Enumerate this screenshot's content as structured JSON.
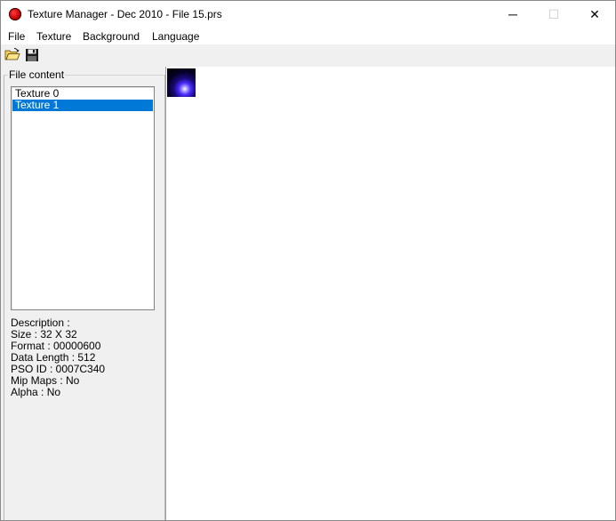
{
  "window": {
    "title": "Texture Manager - Dec 2010 - File 15.prs",
    "icon": "app-logo-icon",
    "controls": {
      "minimize": "─",
      "maximize": "☐",
      "close": "✕"
    }
  },
  "menu": {
    "items": [
      "File",
      "Texture",
      "Background",
      "Language"
    ]
  },
  "toolbar": {
    "buttons": [
      {
        "icon": "open-folder-icon"
      },
      {
        "icon": "save-disk-icon"
      }
    ]
  },
  "left_panel": {
    "group_label": "File content",
    "list": [
      {
        "label": "Texture 0",
        "selected": false
      },
      {
        "label": "Texture 1",
        "selected": true
      }
    ],
    "details": {
      "description": "Description :",
      "size": "Size : 32 X 32",
      "format": "Format : 00000600",
      "data_length": "Data Length : 512",
      "pso_id": "PSO ID : 0007C340",
      "mip_maps": "Mip Maps : No",
      "alpha": "Alpha : No"
    }
  },
  "colors": {
    "selection": "#0078d7",
    "toolbar_bg": "#f0f0f0"
  }
}
